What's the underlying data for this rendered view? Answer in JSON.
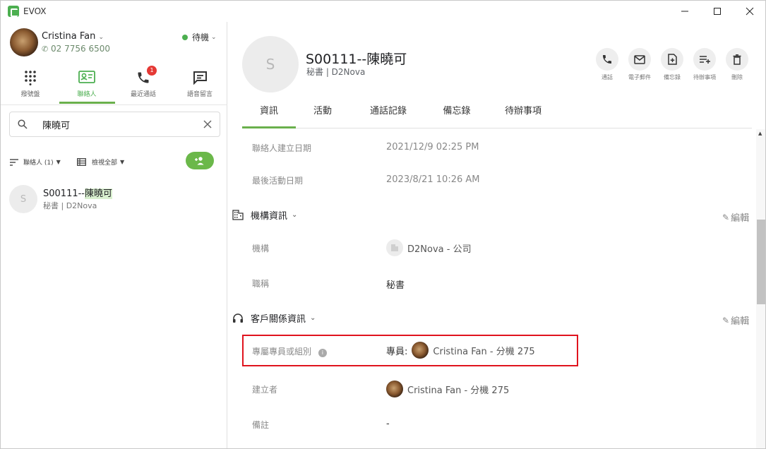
{
  "app": {
    "title": "EVOX"
  },
  "user": {
    "name": "Cristina Fan",
    "phone": "02 7756 6500",
    "status": "待機"
  },
  "nav": [
    {
      "label": "撥號盤",
      "icon": "dialpad-icon"
    },
    {
      "label": "聯絡人",
      "icon": "contacts-icon",
      "active": true
    },
    {
      "label": "最近通話",
      "icon": "recent-calls-icon",
      "badge": "1"
    },
    {
      "label": "語音留言",
      "icon": "voicemail-icon"
    }
  ],
  "search": {
    "value": "陳曉可",
    "placeholder": ""
  },
  "filters": {
    "contacts": "聯絡人 (1)",
    "view": "檢視全部"
  },
  "contacts": [
    {
      "avatar": "S",
      "name_prefix": "S00111--",
      "name_highlight": "陳曉可",
      "subtitle": "秘書 | D2Nova"
    }
  ],
  "detail": {
    "avatar": "S",
    "title": "S00111--陳曉可",
    "subtitle": "秘書 | D2Nova",
    "actions": [
      "通話",
      "電子郵件",
      "備忘錄",
      "待辦事項",
      "刪除"
    ],
    "tabs": [
      "資訊",
      "活動",
      "通話記錄",
      "備忘錄",
      "待辦事項"
    ],
    "fields": {
      "created_label": "聯絡人建立日期",
      "created_value": "2021/12/9 02:25 PM",
      "last_label": "最後活動日期",
      "last_value": "2023/8/21 10:26 AM"
    },
    "org": {
      "section": "機構資訊",
      "edit": "編輯",
      "org_label": "機構",
      "org_value": "D2Nova - 公司",
      "title_label": "職稱",
      "title_value": "秘書"
    },
    "crm": {
      "section": "客戶關係資訊",
      "edit": "編輯",
      "owner_label": "專屬專員或組別",
      "owner_prefix": "專員:",
      "owner_value": "Cristina Fan - 分機 275",
      "creator_label": "建立者",
      "creator_value": "Cristina Fan - 分機 275",
      "note_label": "備註",
      "note_value": "-"
    }
  },
  "colors": {
    "accent": "#6ab04c",
    "highlight_box": "#e0141e",
    "status_online": "#4caf50",
    "badge": "#e53935"
  }
}
